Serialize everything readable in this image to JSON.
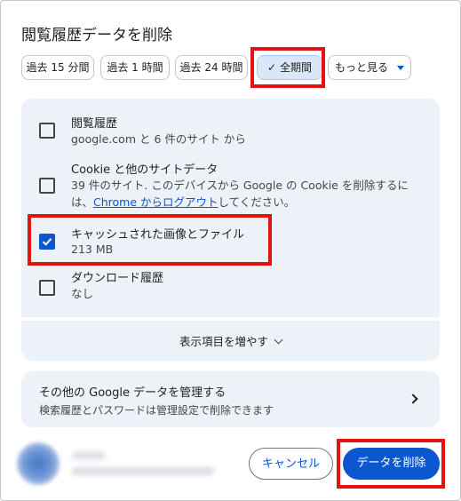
{
  "dialog": {
    "title": "閲覧履歴データを削除"
  },
  "time_range": {
    "chips": [
      {
        "label": "過去 15 分間",
        "selected": false
      },
      {
        "label": "過去 1 時間",
        "selected": false
      },
      {
        "label": "過去 24 時間",
        "selected": false
      },
      {
        "label": "全期間",
        "selected": true
      },
      {
        "label": "もっと見る",
        "selected": false
      }
    ],
    "check_icon": "checkmark-icon",
    "more_icon": "caret-down-icon"
  },
  "options": [
    {
      "title": "閲覧履歴",
      "subtitle": "google.com と 6 件のサイト から",
      "checked": false
    },
    {
      "title": "Cookie と他のサイトデータ",
      "subtitle_pre": "39 件のサイト. このデバイスから Google の Cookie を削除するには、",
      "subtitle_link": "Chrome からログアウト",
      "subtitle_post": "してください。",
      "checked": false
    },
    {
      "title": "キャッシュされた画像とファイル",
      "subtitle": "213 MB",
      "checked": true
    },
    {
      "title": "ダウンロード履歴",
      "subtitle": "なし",
      "checked": false
    }
  ],
  "show_more": {
    "label": "表示項目を増やす",
    "icon": "chevron-down-icon"
  },
  "manage": {
    "title": "その他の Google データを管理する",
    "subtitle": "検索履歴とパスワードは管理設定で削除できます",
    "icon": "chevron-right-icon"
  },
  "footer": {
    "cancel_label": "キャンセル",
    "delete_label": "データを削除"
  },
  "colors": {
    "accent": "#0b57d0",
    "card_bg": "#edf2f9",
    "highlight": "#e11313"
  }
}
